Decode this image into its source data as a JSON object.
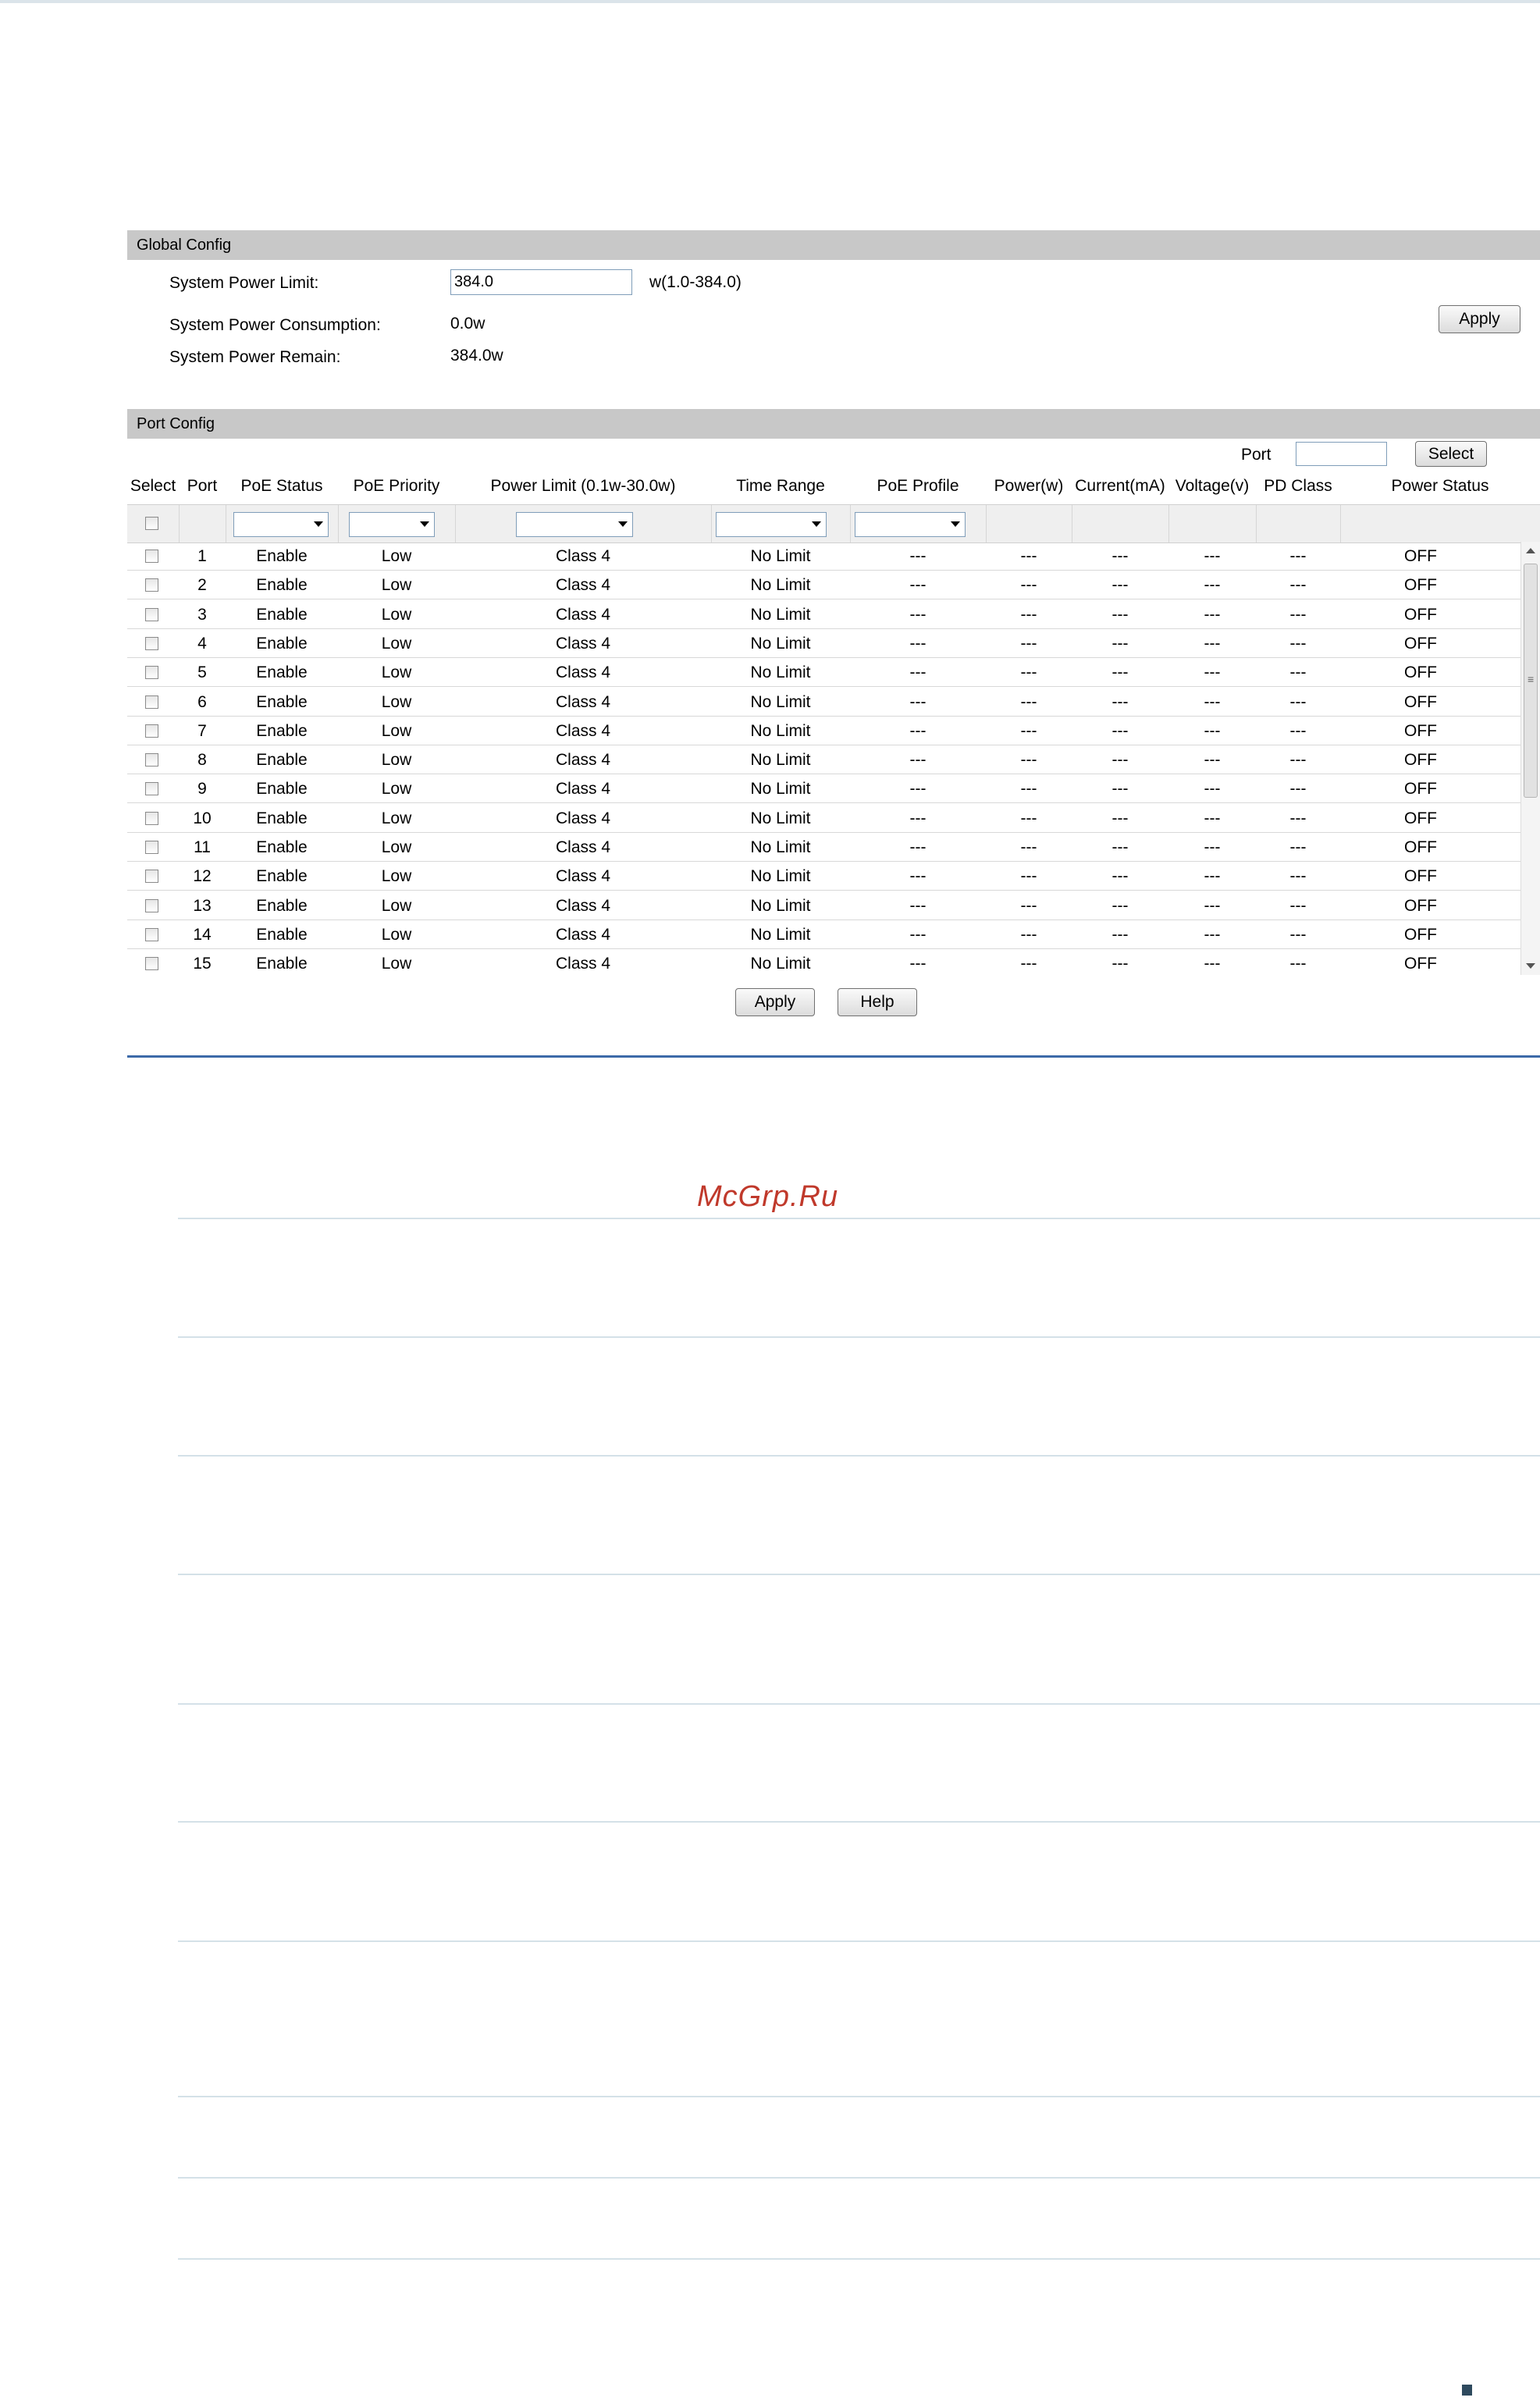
{
  "global_config": {
    "title": "Global Config",
    "system_power_limit_label": "System Power Limit:",
    "system_power_limit_value": "384.0",
    "system_power_limit_range": "w(1.0-384.0)",
    "system_power_consumption_label": "System Power Consumption:",
    "system_power_consumption_value": "0.0w",
    "system_power_remain_label": "System Power Remain:",
    "system_power_remain_value": "384.0w",
    "apply_label": "Apply"
  },
  "port_config": {
    "title": "Port Config",
    "port_search_label": "Port",
    "port_search_value": "",
    "select_button_label": "Select",
    "columns": [
      "Select",
      "Port",
      "PoE Status",
      "PoE Priority",
      "Power Limit (0.1w-30.0w)",
      "Time Range",
      "PoE Profile",
      "Power(w)",
      "Current(mA)",
      "Voltage(v)",
      "PD Class",
      "Power Status"
    ],
    "rows": [
      {
        "port": "1",
        "poe_status": "Enable",
        "priority": "Low",
        "power_limit": "Class 4",
        "time_range": "No Limit",
        "poe_profile": "---",
        "power": "---",
        "current": "---",
        "voltage": "---",
        "pd_class": "---",
        "power_status": "OFF"
      },
      {
        "port": "2",
        "poe_status": "Enable",
        "priority": "Low",
        "power_limit": "Class 4",
        "time_range": "No Limit",
        "poe_profile": "---",
        "power": "---",
        "current": "---",
        "voltage": "---",
        "pd_class": "---",
        "power_status": "OFF"
      },
      {
        "port": "3",
        "poe_status": "Enable",
        "priority": "Low",
        "power_limit": "Class 4",
        "time_range": "No Limit",
        "poe_profile": "---",
        "power": "---",
        "current": "---",
        "voltage": "---",
        "pd_class": "---",
        "power_status": "OFF"
      },
      {
        "port": "4",
        "poe_status": "Enable",
        "priority": "Low",
        "power_limit": "Class 4",
        "time_range": "No Limit",
        "poe_profile": "---",
        "power": "---",
        "current": "---",
        "voltage": "---",
        "pd_class": "---",
        "power_status": "OFF"
      },
      {
        "port": "5",
        "poe_status": "Enable",
        "priority": "Low",
        "power_limit": "Class 4",
        "time_range": "No Limit",
        "poe_profile": "---",
        "power": "---",
        "current": "---",
        "voltage": "---",
        "pd_class": "---",
        "power_status": "OFF"
      },
      {
        "port": "6",
        "poe_status": "Enable",
        "priority": "Low",
        "power_limit": "Class 4",
        "time_range": "No Limit",
        "poe_profile": "---",
        "power": "---",
        "current": "---",
        "voltage": "---",
        "pd_class": "---",
        "power_status": "OFF"
      },
      {
        "port": "7",
        "poe_status": "Enable",
        "priority": "Low",
        "power_limit": "Class 4",
        "time_range": "No Limit",
        "poe_profile": "---",
        "power": "---",
        "current": "---",
        "voltage": "---",
        "pd_class": "---",
        "power_status": "OFF"
      },
      {
        "port": "8",
        "poe_status": "Enable",
        "priority": "Low",
        "power_limit": "Class 4",
        "time_range": "No Limit",
        "poe_profile": "---",
        "power": "---",
        "current": "---",
        "voltage": "---",
        "pd_class": "---",
        "power_status": "OFF"
      },
      {
        "port": "9",
        "poe_status": "Enable",
        "priority": "Low",
        "power_limit": "Class 4",
        "time_range": "No Limit",
        "poe_profile": "---",
        "power": "---",
        "current": "---",
        "voltage": "---",
        "pd_class": "---",
        "power_status": "OFF"
      },
      {
        "port": "10",
        "poe_status": "Enable",
        "priority": "Low",
        "power_limit": "Class 4",
        "time_range": "No Limit",
        "poe_profile": "---",
        "power": "---",
        "current": "---",
        "voltage": "---",
        "pd_class": "---",
        "power_status": "OFF"
      },
      {
        "port": "11",
        "poe_status": "Enable",
        "priority": "Low",
        "power_limit": "Class 4",
        "time_range": "No Limit",
        "poe_profile": "---",
        "power": "---",
        "current": "---",
        "voltage": "---",
        "pd_class": "---",
        "power_status": "OFF"
      },
      {
        "port": "12",
        "poe_status": "Enable",
        "priority": "Low",
        "power_limit": "Class 4",
        "time_range": "No Limit",
        "poe_profile": "---",
        "power": "---",
        "current": "---",
        "voltage": "---",
        "pd_class": "---",
        "power_status": "OFF"
      },
      {
        "port": "13",
        "poe_status": "Enable",
        "priority": "Low",
        "power_limit": "Class 4",
        "time_range": "No Limit",
        "poe_profile": "---",
        "power": "---",
        "current": "---",
        "voltage": "---",
        "pd_class": "---",
        "power_status": "OFF"
      },
      {
        "port": "14",
        "poe_status": "Enable",
        "priority": "Low",
        "power_limit": "Class 4",
        "time_range": "No Limit",
        "poe_profile": "---",
        "power": "---",
        "current": "---",
        "voltage": "---",
        "pd_class": "---",
        "power_status": "OFF"
      },
      {
        "port": "15",
        "poe_status": "Enable",
        "priority": "Low",
        "power_limit": "Class 4",
        "time_range": "No Limit",
        "poe_profile": "---",
        "power": "---",
        "current": "---",
        "voltage": "---",
        "pd_class": "---",
        "power_status": "OFF"
      }
    ],
    "apply_label": "Apply",
    "help_label": "Help"
  },
  "watermark": "McGrp.Ru",
  "colors": {
    "section_bar": "#c8c8c8",
    "blue_rule": "#3d6aa8",
    "watermark": "#c0392b"
  }
}
